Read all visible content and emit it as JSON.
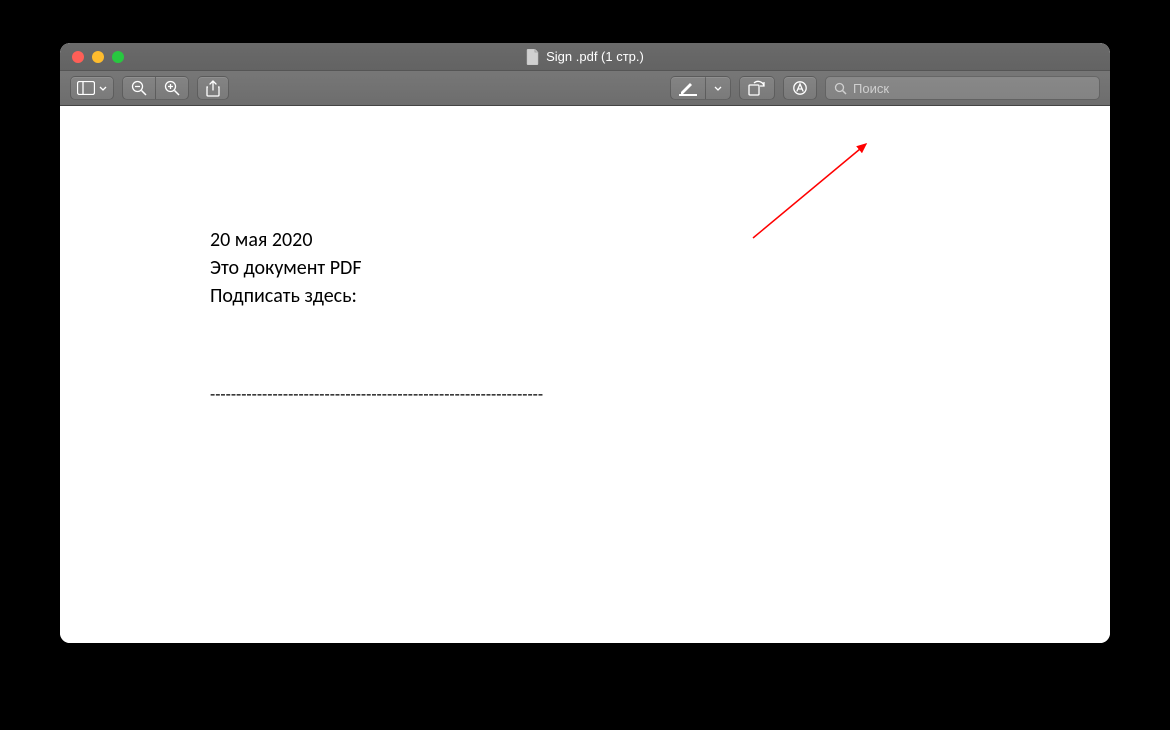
{
  "window": {
    "title": "Sign .pdf (1 стр.)"
  },
  "toolbar": {
    "search_placeholder": "Поиск"
  },
  "document": {
    "line1": "20 мая 2020",
    "line2": "Это документ PDF",
    "line3": "Подписать здесь:",
    "separator": "----------------------------------------------------------------"
  }
}
